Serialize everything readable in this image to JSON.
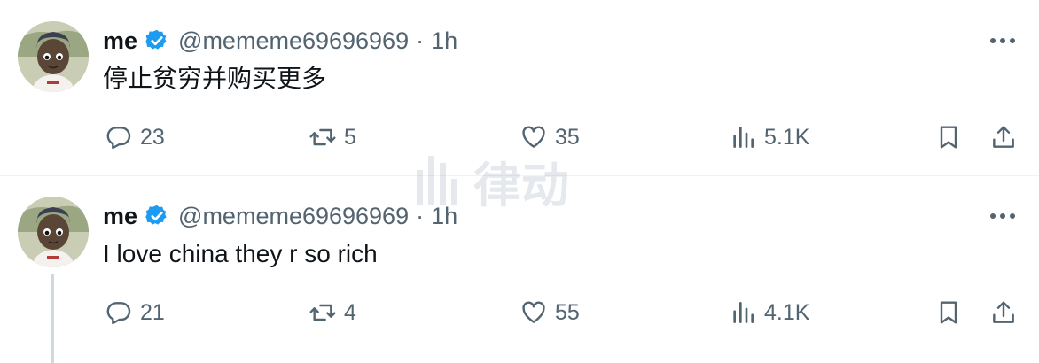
{
  "tweets": [
    {
      "name": "me",
      "handle": "@mememe69696969",
      "separator": "·",
      "time": "1h",
      "text": "停止贫穷并购买更多",
      "stats": {
        "replies": "23",
        "reposts": "5",
        "likes": "35",
        "views": "5.1K"
      }
    },
    {
      "name": "me",
      "handle": "@mememe69696969",
      "separator": "·",
      "time": "1h",
      "text": "I love china they r so rich",
      "stats": {
        "replies": "21",
        "reposts": "4",
        "likes": "55",
        "views": "4.1K"
      }
    }
  ],
  "watermark": {
    "text": "律动"
  },
  "colors": {
    "verified": "#1d9bf0",
    "secondary_text": "#536471",
    "primary_text": "#0f1419",
    "thread_line": "#cfd9de"
  },
  "icons": [
    "verified-badge-icon",
    "more-options-icon",
    "reply-icon",
    "repost-icon",
    "like-icon",
    "views-icon",
    "bookmark-icon",
    "share-icon"
  ]
}
